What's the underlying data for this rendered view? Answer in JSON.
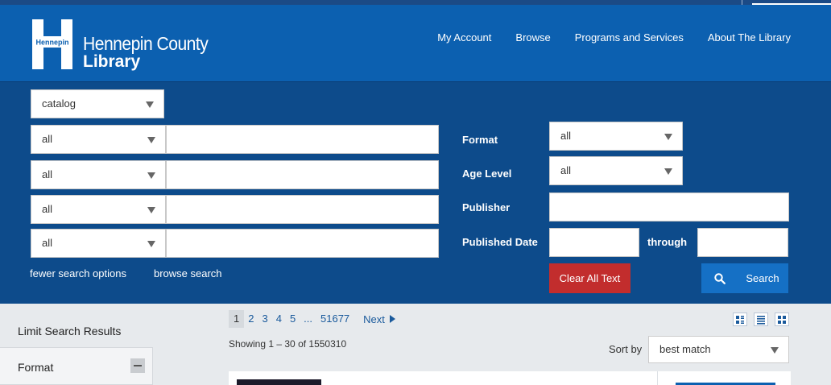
{
  "header": {
    "logo_mark_text": "Hennepin",
    "logo_line1": "Hennepin County",
    "logo_line2": "Library",
    "nav": [
      "My Account",
      "Browse",
      "Programs and Services",
      "About The Library"
    ]
  },
  "search": {
    "catalog_select": "catalog",
    "field_selects": [
      "all",
      "all",
      "all",
      "all"
    ],
    "format_label": "Format",
    "format_value": "all",
    "age_label": "Age Level",
    "age_value": "all",
    "publisher_label": "Publisher",
    "pubdate_label": "Published Date",
    "through_label": "through",
    "fewer_link": "fewer search options",
    "browse_link": "browse search",
    "clear_label": "Clear All Text",
    "search_label": "Search"
  },
  "sidebar": {
    "title": "Limit Search Results",
    "format_panel": "Format"
  },
  "results": {
    "pages": [
      "1",
      "2",
      "3",
      "4",
      "5",
      "...",
      "51677"
    ],
    "next_label": "Next",
    "showing": "Showing 1 – 30 of 1550310",
    "sort_label": "Sort by",
    "sort_value": "best match"
  },
  "colors": {
    "header_blue": "#0c60b0",
    "search_band": "#0d4b8b",
    "clear_red": "#c22d2d",
    "search_blue": "#1570c5"
  },
  "icons": {
    "search": "magnifier-icon",
    "view_modes": [
      "grid-detail-icon",
      "list-icon",
      "grid-icon"
    ]
  }
}
